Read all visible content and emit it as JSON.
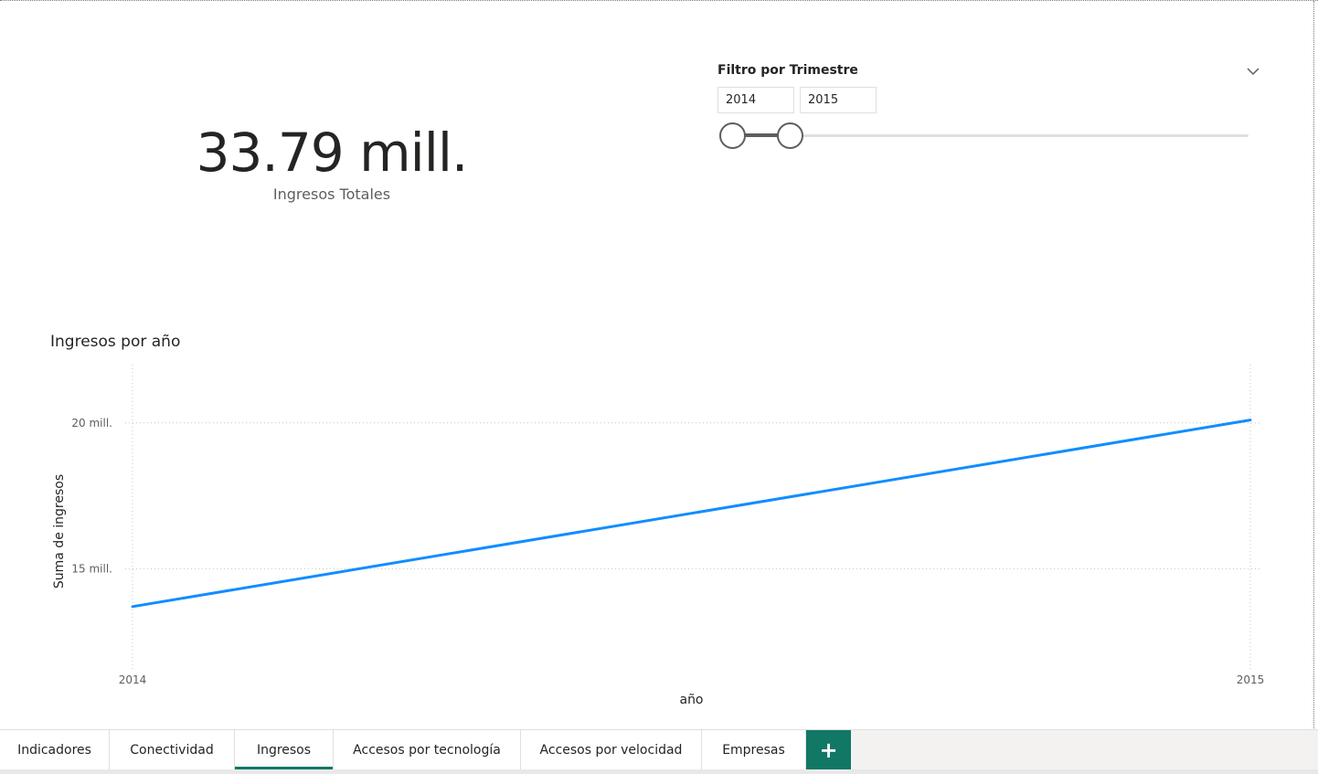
{
  "kpi": {
    "value": "33.79 mill.",
    "label": "Ingresos Totales"
  },
  "slicer": {
    "title": "Filtro por Trimestre",
    "from": "2014",
    "to": "2015",
    "selected_range": [
      2014,
      2015
    ],
    "icons": {
      "expand": "chevron-down-icon"
    }
  },
  "chart": {
    "title": "Ingresos por año",
    "xlabel": "año",
    "ylabel": "Suma de ingresos",
    "ytick_labels": [
      "20 mill.",
      "15 mill."
    ],
    "xtick_labels": [
      "2014",
      "2015"
    ]
  },
  "chart_data": {
    "type": "line",
    "title": "Ingresos por año",
    "xlabel": "año",
    "ylabel": "Suma de ingresos",
    "x": [
      2014,
      2015
    ],
    "series": [
      {
        "values": [
          13.7,
          20.1
        ]
      }
    ],
    "yticks": [
      15,
      20
    ],
    "ylim": [
      11.5,
      22
    ],
    "xlim": [
      2014,
      2015
    ],
    "grid": true,
    "color": "#118dff"
  },
  "tabs": [
    {
      "label": "Indicadores",
      "active": false
    },
    {
      "label": "Conectividad",
      "active": false
    },
    {
      "label": "Ingresos",
      "active": true
    },
    {
      "label": "Accesos por tecnología",
      "active": false
    },
    {
      "label": "Accesos por velocidad",
      "active": false
    },
    {
      "label": "Empresas",
      "active": false
    }
  ],
  "add_tab": {
    "label": "+"
  },
  "colors": {
    "accent": "#117865",
    "line": "#118dff"
  }
}
